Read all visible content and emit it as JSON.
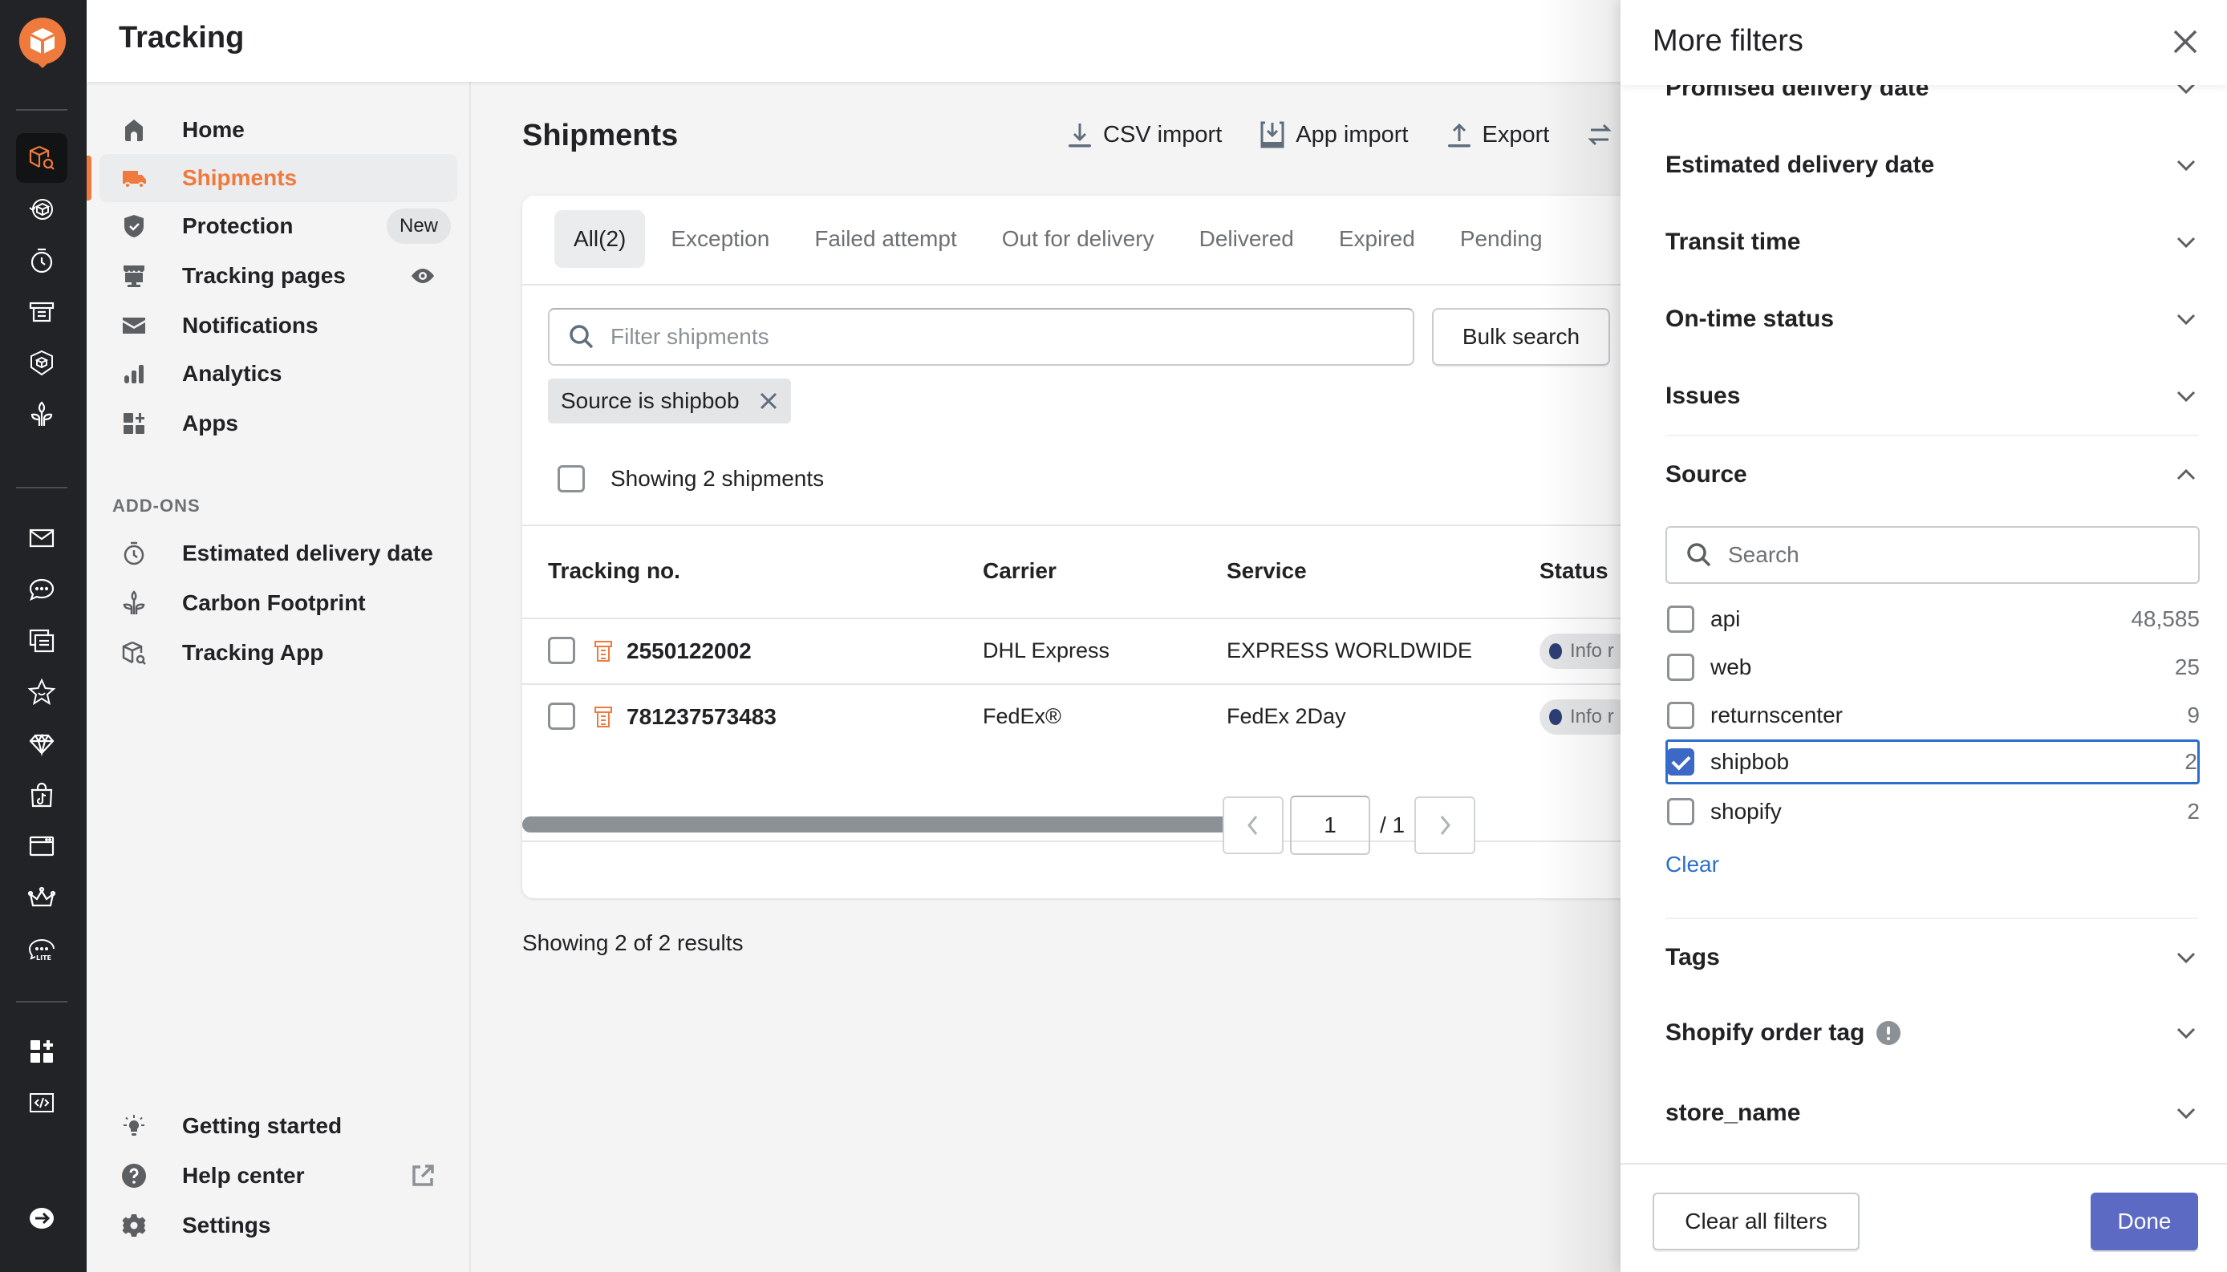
{
  "app": {
    "title": "Tracking",
    "brand_color": "#ef7a3e",
    "primary_color": "#5c6ac4",
    "link_color": "#2c6ecb"
  },
  "rail": {
    "icons": [
      "tracking-app-icon",
      "returns-icon",
      "edd-icon",
      "tracking-pages-icon",
      "protection-icon",
      "carbon-icon",
      "email-icon",
      "chat-icon",
      "messages-icon",
      "reviews-icon",
      "loyalty-icon",
      "tiktok-shop-icon",
      "browser-icon",
      "crown-icon",
      "chat-lite-icon",
      "apps-icon",
      "developer-icon",
      "collapse-icon"
    ],
    "active": "tracking-app-icon"
  },
  "nav": {
    "items": [
      {
        "label": "Home",
        "icon": "home-icon"
      },
      {
        "label": "Shipments",
        "icon": "truck-icon",
        "active": true
      },
      {
        "label": "Protection",
        "icon": "shield-check-icon",
        "badge": "New"
      },
      {
        "label": "Tracking pages",
        "icon": "storefront-icon",
        "trailing_icon": "eye-icon"
      },
      {
        "label": "Notifications",
        "icon": "envelope-icon"
      },
      {
        "label": "Analytics",
        "icon": "bar-chart-icon"
      },
      {
        "label": "Apps",
        "icon": "apps-icon"
      }
    ],
    "addons_label": "ADD-ONS",
    "addons": [
      {
        "label": "Estimated delivery date",
        "icon": "stopwatch-icon"
      },
      {
        "label": "Carbon Footprint",
        "icon": "plant-icon"
      },
      {
        "label": "Tracking App",
        "icon": "box-search-icon"
      }
    ],
    "footer": [
      {
        "label": "Getting started",
        "icon": "lightbulb-icon"
      },
      {
        "label": "Help center",
        "icon": "question-icon",
        "trailing_icon": "external-link-icon"
      },
      {
        "label": "Settings",
        "icon": "gear-icon"
      }
    ]
  },
  "main": {
    "title": "Shipments",
    "actions": [
      {
        "label": "CSV import",
        "icon": "download-icon"
      },
      {
        "label": "App import",
        "icon": "app-import-icon"
      },
      {
        "label": "Export",
        "icon": "upload-icon"
      }
    ],
    "tabs": [
      {
        "label": "All(2)",
        "active": true
      },
      {
        "label": "Exception"
      },
      {
        "label": "Failed attempt"
      },
      {
        "label": "Out for delivery"
      },
      {
        "label": "Delivered"
      },
      {
        "label": "Expired"
      },
      {
        "label": "Pending"
      }
    ],
    "search_placeholder": "Filter shipments",
    "bulk_search_label": "Bulk search",
    "active_filter": "Source is shipbob",
    "showing_label": "Showing 2 shipments",
    "columns": [
      "Tracking no.",
      "Carrier",
      "Service",
      "Status"
    ],
    "rows": [
      {
        "tracking_no": "2550122002",
        "carrier": "DHL Express",
        "service": "EXPRESS WORLDWIDE",
        "status": "Info r"
      },
      {
        "tracking_no": "781237573483",
        "carrier": "FedEx®",
        "service": "FedEx 2Day",
        "status": "Info r"
      }
    ],
    "pagination": {
      "current": "1",
      "total": "/ 1"
    },
    "results_label": "Showing 2 of 2 results"
  },
  "drawer": {
    "title": "More filters",
    "sections_above": [
      {
        "label": "Promised delivery date"
      },
      {
        "label": "Estimated delivery date"
      },
      {
        "label": "Transit time"
      },
      {
        "label": "On-time status"
      },
      {
        "label": "Issues"
      }
    ],
    "source": {
      "label": "Source",
      "search_placeholder": "Search",
      "options": [
        {
          "label": "api",
          "count": "48,585",
          "checked": false
        },
        {
          "label": "web",
          "count": "25",
          "checked": false
        },
        {
          "label": "returnscenter",
          "count": "9",
          "checked": false
        },
        {
          "label": "shipbob",
          "count": "2",
          "checked": true
        },
        {
          "label": "shopify",
          "count": "2",
          "checked": false
        }
      ],
      "clear_label": "Clear"
    },
    "sections_below": [
      {
        "label": "Tags"
      },
      {
        "label": "Shopify order tag",
        "info_icon": true
      },
      {
        "label": "store_name"
      }
    ],
    "clear_all_label": "Clear all filters",
    "done_label": "Done"
  }
}
